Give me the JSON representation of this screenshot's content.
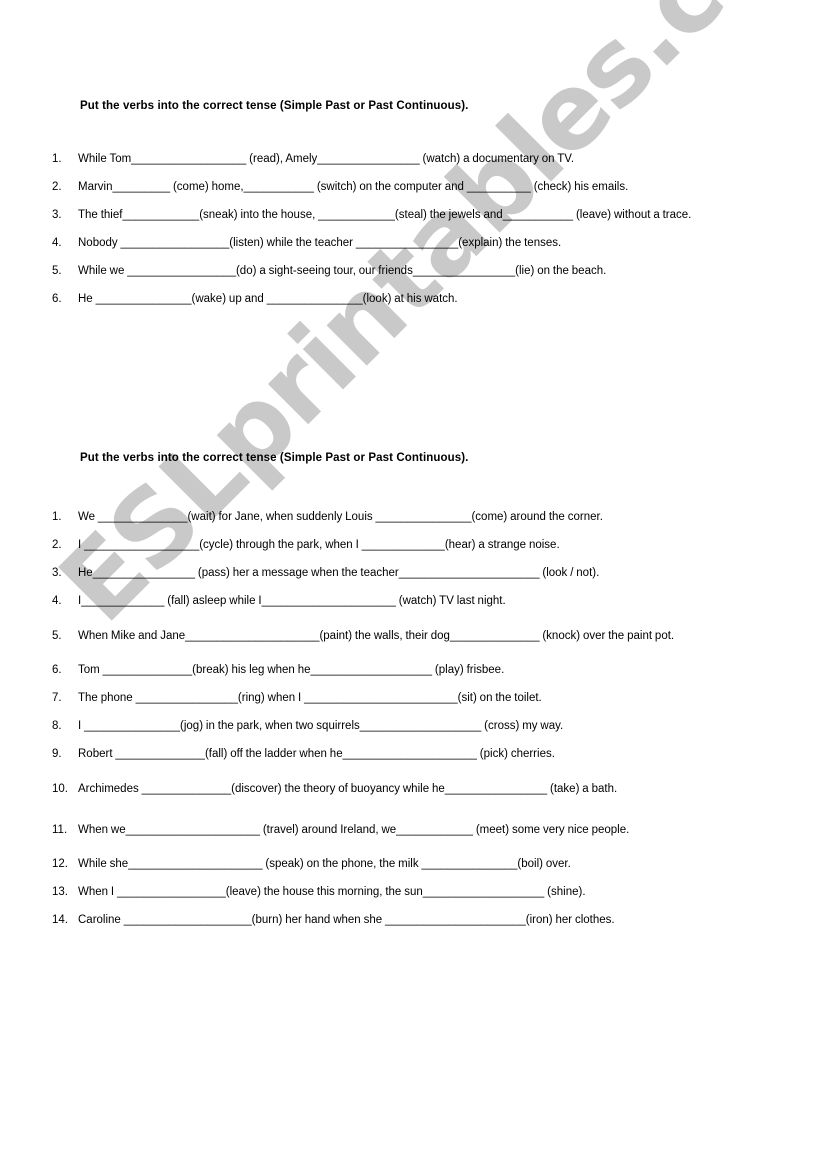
{
  "page": {
    "background_color": "#ffffff",
    "text_color": "#000000"
  },
  "watermark": {
    "text": "ESLprintables.com",
    "color": "#c9c9c9",
    "rotation_deg": -45
  },
  "exercise_1": {
    "heading": "Put the verbs into the correct tense (Simple Past or Past Continuous).",
    "items": [
      {
        "number": "1.",
        "text": "While Tom__________________ (read), Amely________________ (watch) a documentary on TV."
      },
      {
        "number": "2.",
        "text": "Marvin_________ (come) home,___________ (switch) on the computer and __________ (check) his emails."
      },
      {
        "number": "3.",
        "text": "The thief____________(sneak) into the house, ____________(steal) the jewels and___________ (leave) without a trace."
      },
      {
        "number": "4.",
        "text": "Nobody _________________(listen) while the teacher ________________(explain) the tenses."
      },
      {
        "number": "5.",
        "text": "While we _________________(do) a sight-seeing tour, our friends________________(lie) on the beach."
      },
      {
        "number": "6.",
        "text": "He _______________(wake) up and _______________(look) at his watch."
      }
    ]
  },
  "exercise_2": {
    "heading": "Put the verbs into the correct tense (Simple Past or Past Continuous).",
    "items": [
      {
        "number": "1.",
        "text": "We ______________(wait) for Jane, when suddenly Louis _______________(come) around the corner."
      },
      {
        "number": "2.",
        "text": "I __________________(cycle) through the park, when I _____________(hear) a strange noise."
      },
      {
        "number": "3.",
        "text": "He________________ (pass) her a message when the teacher______________________ (look / not)."
      },
      {
        "number": "4.",
        "text": "I_____________ (fall) asleep while I_____________________ (watch) TV last night."
      },
      {
        "number": "5.",
        "text": "When Mike and Jane_____________________(paint) the walls, their dog______________ (knock) over the paint pot."
      },
      {
        "number": "6.",
        "text": "Tom ______________(break) his leg when he___________________ (play) frisbee."
      },
      {
        "number": "7.",
        "text": "The phone ________________(ring) when I ________________________(sit) on the toilet."
      },
      {
        "number": "8.",
        "text": "I _______________(jog) in the park, when two squirrels___________________ (cross) my way."
      },
      {
        "number": "9.",
        "text": "Robert ______________(fall) off the ladder when he_____________________ (pick) cherries."
      },
      {
        "number": "10.",
        "text": "Archimedes ______________(discover) the theory of buoyancy while he________________ (take) a bath."
      },
      {
        "number": "11.",
        "text": "When we_____________________ (travel) around Ireland, we____________ (meet) some very nice people."
      },
      {
        "number": "12.",
        "text": "While she_____________________ (speak) on the phone, the milk _______________(boil) over."
      },
      {
        "number": "13.",
        "text": "When I _________________(leave) the house this morning, the sun___________________ (shine)."
      },
      {
        "number": "14.",
        "text": "Caroline ____________________(burn) her hand when she ______________________(iron) her clothes."
      }
    ]
  }
}
